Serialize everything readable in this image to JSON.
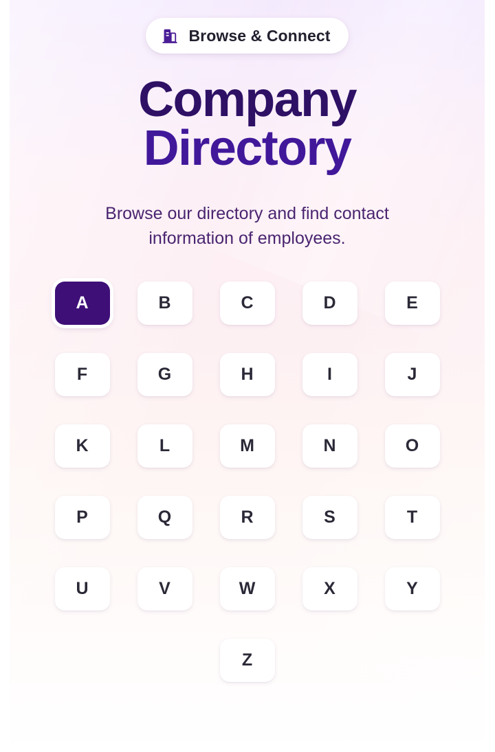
{
  "badge": {
    "icon": "building-icon",
    "label": "Browse & Connect"
  },
  "header": {
    "title_line1": "Company",
    "title_line2": "Directory",
    "subtitle": "Browse our directory and find contact information of employees."
  },
  "alphabet_filter": {
    "selected": "A",
    "rows": [
      [
        "A",
        "B",
        "C",
        "D",
        "E"
      ],
      [
        "F",
        "G",
        "H",
        "I",
        "J"
      ],
      [
        "K",
        "L",
        "M",
        "N",
        "O"
      ],
      [
        "P",
        "Q",
        "R",
        "S",
        "T"
      ],
      [
        "U",
        "V",
        "W",
        "X",
        "Y"
      ]
    ],
    "last_row": [
      "Z"
    ],
    "letters": [
      "A",
      "B",
      "C",
      "D",
      "E",
      "F",
      "G",
      "H",
      "I",
      "J",
      "K",
      "L",
      "M",
      "N",
      "O",
      "P",
      "Q",
      "R",
      "S",
      "T",
      "U",
      "V",
      "W",
      "X",
      "Y",
      "Z"
    ]
  },
  "colors": {
    "accent_purple": "#3f0f78",
    "title_purple": "#2e1065",
    "title_purple_alt": "#41189a",
    "subtitle_purple": "#4a2470",
    "letter_dark": "#2b2937",
    "surface_white": "#ffffff",
    "bg_top": "#f3e8fd",
    "bg_mid": "#fdeff4",
    "bg_bottom": "#ffffff"
  }
}
